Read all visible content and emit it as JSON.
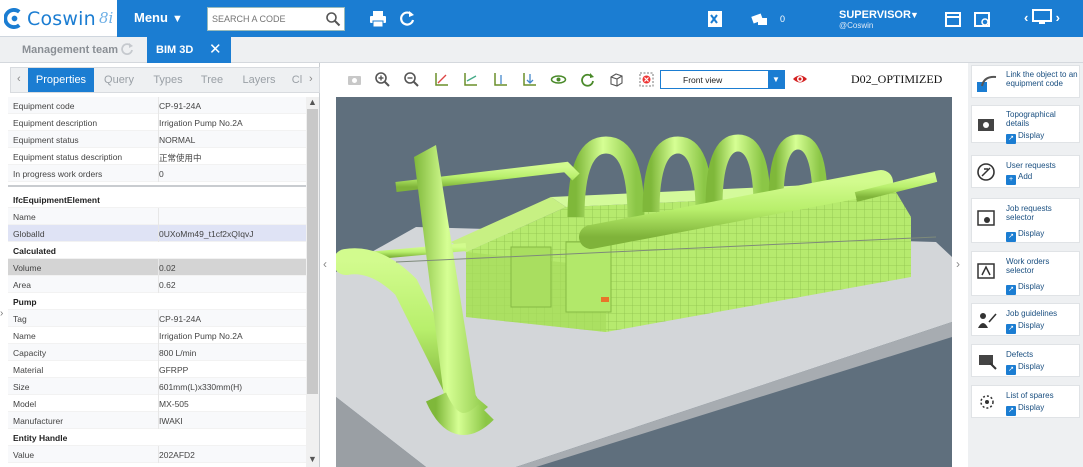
{
  "app": {
    "logo_text": "Coswin",
    "logo_version": "8i",
    "menu_label": "Menu",
    "search_placeholder": "SEARCH A CODE",
    "notification_count": "0",
    "user_name": "SUPERVISOR",
    "user_sub": "@Coswin",
    "accent_color": "#1b7dd2"
  },
  "tabs": [
    {
      "label": "Management team",
      "active": false
    },
    {
      "label": "BIM 3D",
      "active": true
    }
  ],
  "subtabs": [
    "Properties",
    "Query",
    "Types",
    "Tree",
    "Layers",
    "Cl"
  ],
  "properties": {
    "general": [
      {
        "key": "Equipment code",
        "value": "CP-91-24A"
      },
      {
        "key": "Equipment description",
        "value": "Irrigation Pump No.2A"
      },
      {
        "key": "Equipment status",
        "value": "NORMAL"
      },
      {
        "key": "Equipment status description",
        "value": "正常使用中"
      },
      {
        "key": "In progress work orders",
        "value": "0"
      }
    ],
    "sections": [
      {
        "title": "IfcEquipmentElement",
        "rows": [
          {
            "key": "Name",
            "value": ""
          },
          {
            "key": "GlobalId",
            "value": "0UXoMm49_t1cf2xQIqvJ",
            "selected": true
          }
        ]
      },
      {
        "title": "Calculated",
        "rows": [
          {
            "key": "Volume",
            "value": "0.02",
            "dark": true
          },
          {
            "key": "Area",
            "value": "0.62"
          }
        ]
      },
      {
        "title": "Pump",
        "rows": [
          {
            "key": "Tag",
            "value": "CP-91-24A"
          },
          {
            "key": "Name",
            "value": "Irrigation Pump No.2A"
          },
          {
            "key": "Capacity",
            "value": "800 L/min"
          },
          {
            "key": "Material",
            "value": "GFRPP"
          },
          {
            "key": "Size",
            "value": "601mm(L)x330mm(H)"
          },
          {
            "key": "Model",
            "value": "MX-505"
          },
          {
            "key": "Manufacturer",
            "value": "IWAKI"
          }
        ]
      },
      {
        "title": "Entity Handle",
        "rows": [
          {
            "key": "Value",
            "value": "202AFD2"
          }
        ]
      }
    ]
  },
  "viewer": {
    "view_select": "Front view",
    "model_name": "D02_OPTIMIZED",
    "background_color": "#5f6f7d",
    "pipe_color": "#b7f06a"
  },
  "right_panel": [
    {
      "icon": "link-equipment-icon",
      "title": "Link the object to an equipment code",
      "action": ""
    },
    {
      "icon": "topographical-icon",
      "title": "Topographical details",
      "action": "Display"
    },
    {
      "icon": "user-requests-icon",
      "title": "User requests",
      "action": "Add"
    },
    {
      "icon": "job-requests-icon",
      "title": "Job requests selector",
      "action": "Display"
    },
    {
      "icon": "work-orders-icon",
      "title": "Work orders selector",
      "action": "Display"
    },
    {
      "icon": "job-guidelines-icon",
      "title": "Job guidelines",
      "action": "Display"
    },
    {
      "icon": "defects-icon",
      "title": "Defects",
      "action": "Display"
    },
    {
      "icon": "spares-icon",
      "title": "List of spares",
      "action": "Display"
    }
  ]
}
